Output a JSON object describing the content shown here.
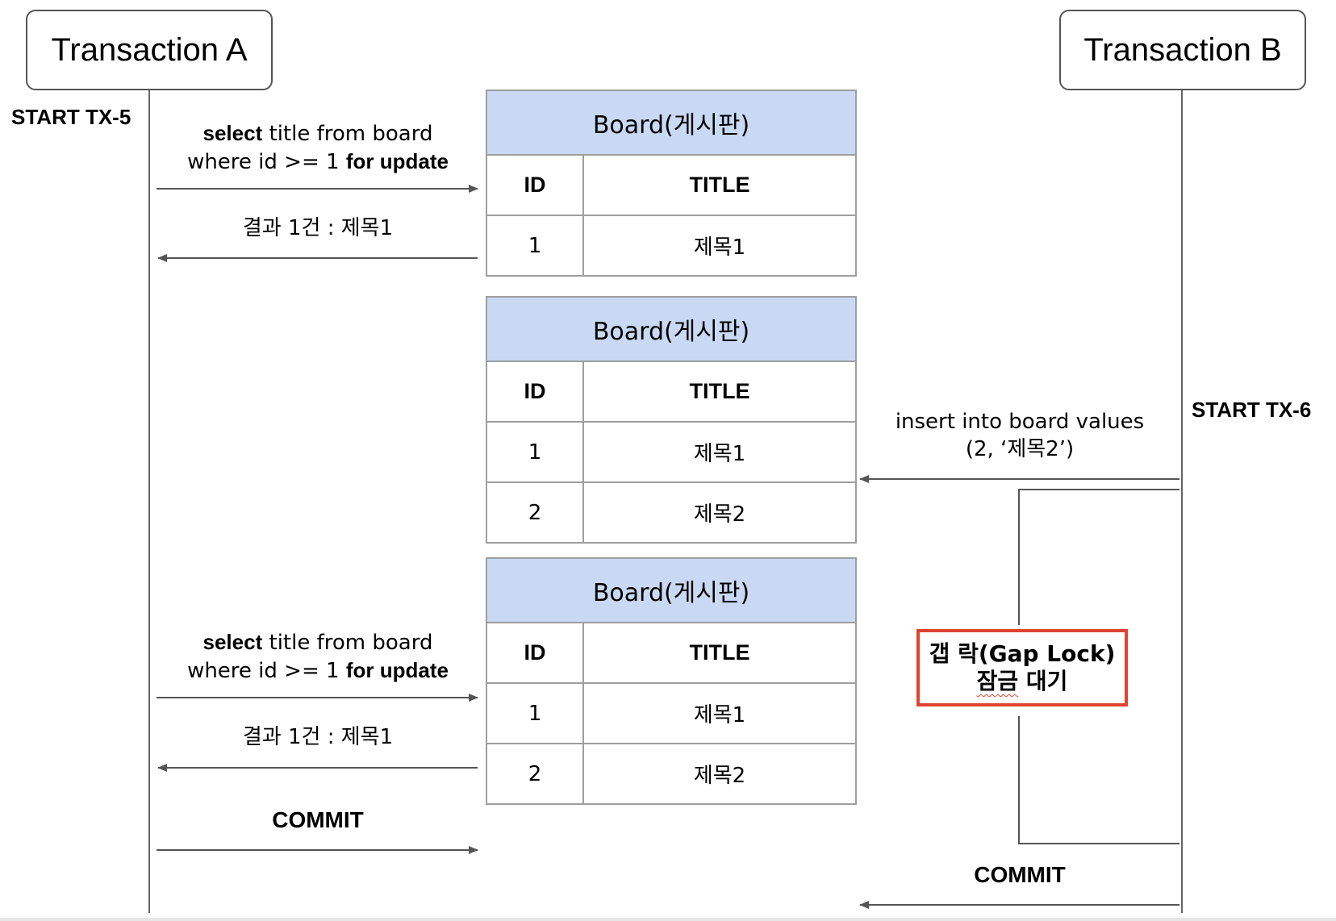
{
  "actors": {
    "a": "Transaction A",
    "b": "Transaction B"
  },
  "start_a": "START TX-5",
  "start_b": "START TX-6",
  "query1": {
    "kw1": "select",
    "mid": " title from board",
    "line2a": "where id >= 1 ",
    "kw2": "for update"
  },
  "result1": "결과 1건 : 제목1",
  "query2": {
    "kw1": "select",
    "mid": " title from board",
    "line2a": "where id >= 1 ",
    "kw2": "for update"
  },
  "result2": "결과 1건 : 제목1",
  "commit_a": "COMMIT",
  "insert_msg": {
    "line1": "insert into board values",
    "line2": "(2, ‘제목2’)"
  },
  "gap_lock": {
    "line1": "갭 락(Gap Lock)",
    "line2a": "잠금",
    "line2b": " 대기"
  },
  "commit_b": "COMMIT",
  "tables": [
    {
      "title": "Board(게시판)",
      "col_id": "ID",
      "col_title": "TITLE",
      "rows": [
        {
          "id": "1",
          "title": "제목1"
        }
      ]
    },
    {
      "title": "Board(게시판)",
      "col_id": "ID",
      "col_title": "TITLE",
      "rows": [
        {
          "id": "1",
          "title": "제목1"
        },
        {
          "id": "2",
          "title": "제목2"
        }
      ]
    },
    {
      "title": "Board(게시판)",
      "col_id": "ID",
      "col_title": "TITLE",
      "rows": [
        {
          "id": "1",
          "title": "제목1"
        },
        {
          "id": "2",
          "title": "제목2"
        }
      ]
    }
  ],
  "colors": {
    "table_header": "#c9d9f3",
    "gap_lock_border": "#e0432f",
    "line": "#555555"
  }
}
